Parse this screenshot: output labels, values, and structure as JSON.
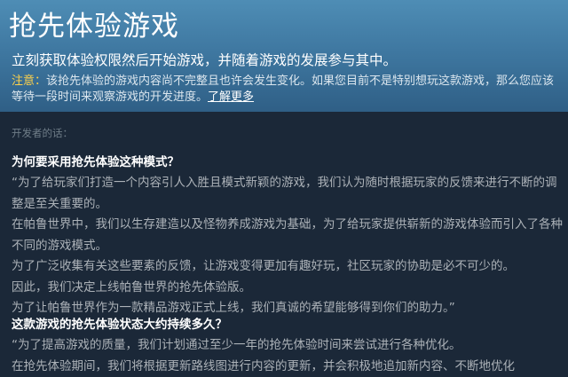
{
  "header": {
    "title": "抢先体验游戏",
    "subtitle": "立刻获取体验权限然后开始游戏，并随着游戏的发展参与其中。",
    "notice_label": "注意：",
    "notice_text": "该抢先体验的游戏内容尚不完整且也许会发生变化。如果您目前不是特别想玩这款游戏，那么您应该等待一段时间来观察游戏的开发进度。",
    "notice_link": "了解更多"
  },
  "developer": {
    "label": "开发者的话：",
    "sections": [
      {
        "question": "为何要采用抢先体验这种模式？",
        "paragraphs": [
          "“为了给玩家们打造一个内容引人入胜且模式新颖的游戏，我们认为随时根据玩家的反馈来进行不断的调整是至关重要的。",
          "在帕鲁世界中，我们以生存建造以及怪物养成游戏为基础，为了给玩家提供崭新的游戏体验而引入了各种不同的游戏模式。",
          "为了广泛收集有关这些要素的反馈，让游戏变得更加有趣好玩，社区玩家的协助是必不可少的。",
          "因此，我们决定上线帕鲁世界的抢先体验版。",
          "为了让帕鲁世界作为一款精品游戏正式上线，我们真诚的希望能够得到你们的助力。”"
        ]
      },
      {
        "question": "这款游戏的抢先体验状态大约持续多久？",
        "paragraphs": [
          "“为了提高游戏的质量，我们计划通过至少一年的抢先体验时间来尝试进行各种优化。",
          "在抢先体验期间，我们将根据更新路线图进行内容的更新，并会积极地追加新内容、不断地优化"
        ]
      }
    ]
  }
}
